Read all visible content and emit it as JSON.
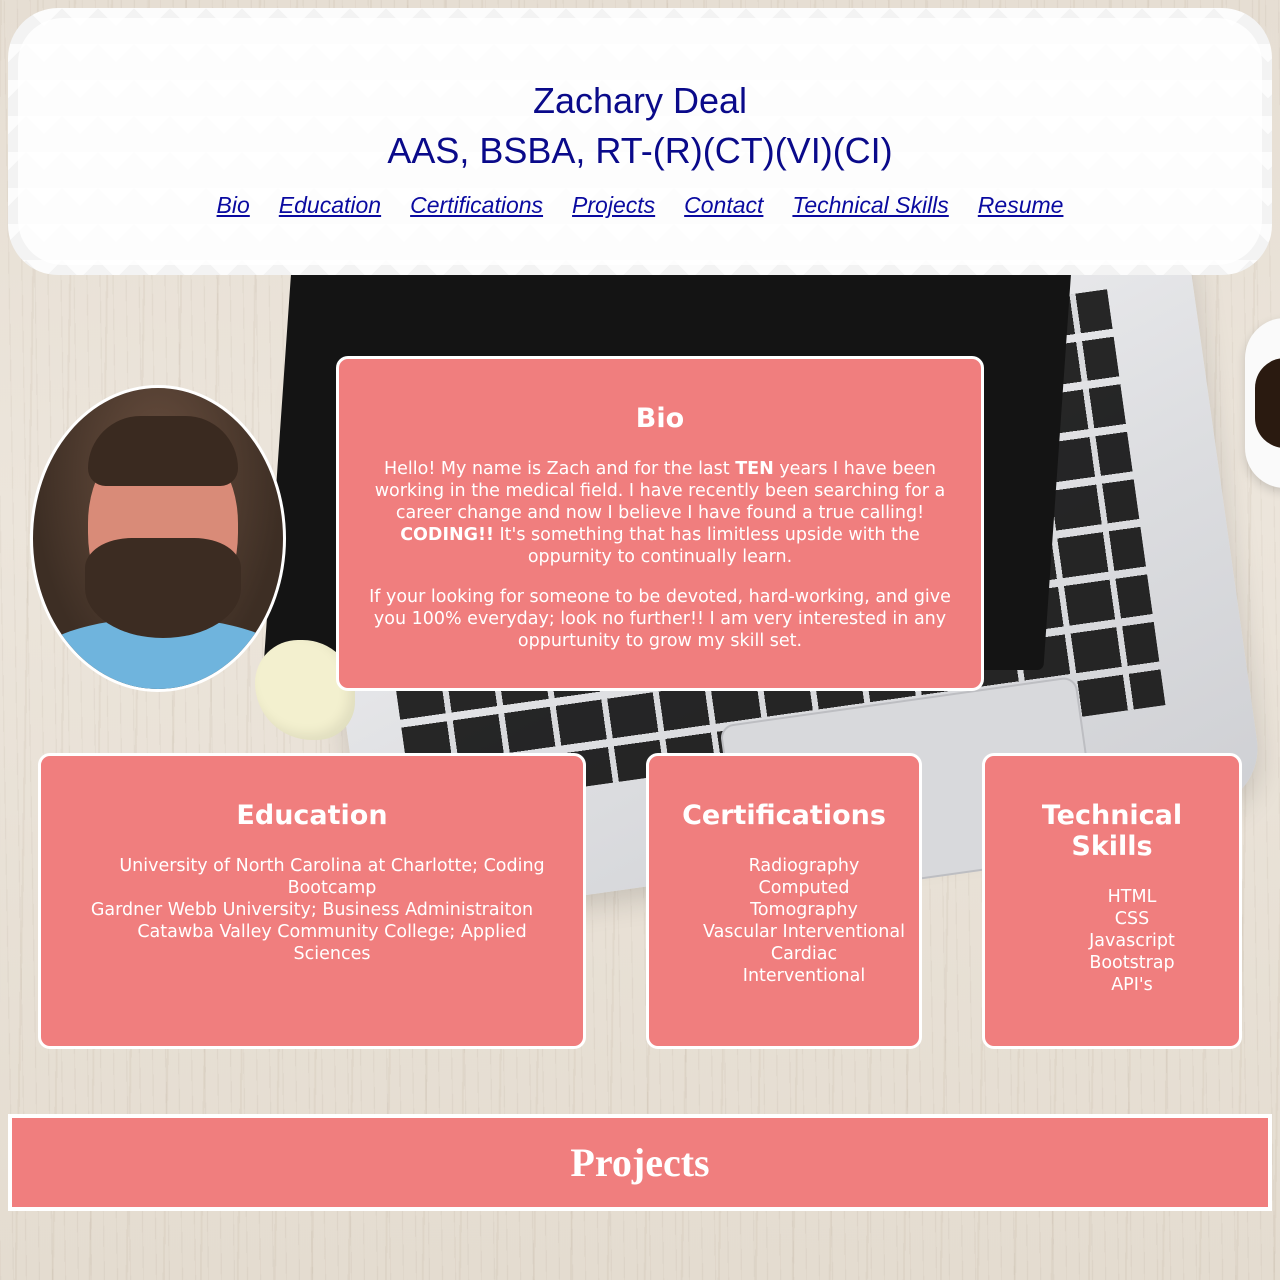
{
  "header": {
    "name": "Zachary Deal",
    "credentials": "AAS, BSBA, RT-(R)(CT)(VI)(CI)",
    "nav": [
      "Bio",
      "Education",
      "Certifications",
      "Projects",
      "Contact",
      "Technical Skills",
      "Resume"
    ]
  },
  "bio": {
    "title": "Bio",
    "p1_a": "Hello! My name is Zach and for the last ",
    "p1_bold1": "TEN",
    "p1_b": " years I have been working in the medical field. I have recently been searching for a career change and now I believe I have found a true calling! ",
    "p1_bold2": "CODING!!",
    "p1_c": " It's something that has limitless upside with the oppurnity to continually learn.",
    "p2": "If your looking for someone to be devoted, hard-working, and give you 100% everyday; look no further!! I am very interested in any oppurtunity to grow my skill set."
  },
  "education": {
    "title": "Education",
    "items": [
      "University of North Carolina at Charlotte; Coding Bootcamp",
      "Gardner Webb University; Business Administraiton",
      "Catawba Valley Community College; Applied Sciences"
    ]
  },
  "certifications": {
    "title": "Certifications",
    "items": [
      "Radiography",
      "Computed Tomography",
      "Vascular Interventional",
      "Cardiac Interventional"
    ]
  },
  "skills": {
    "title": "Technical Skills",
    "items": [
      "HTML",
      "CSS",
      "Javascript",
      "Bootstrap",
      "API's"
    ]
  },
  "projects": {
    "title": "Projects"
  },
  "colors": {
    "card": "#f07e7e",
    "heading_text": "#0a0a8a",
    "link": "#0a0aa0"
  }
}
